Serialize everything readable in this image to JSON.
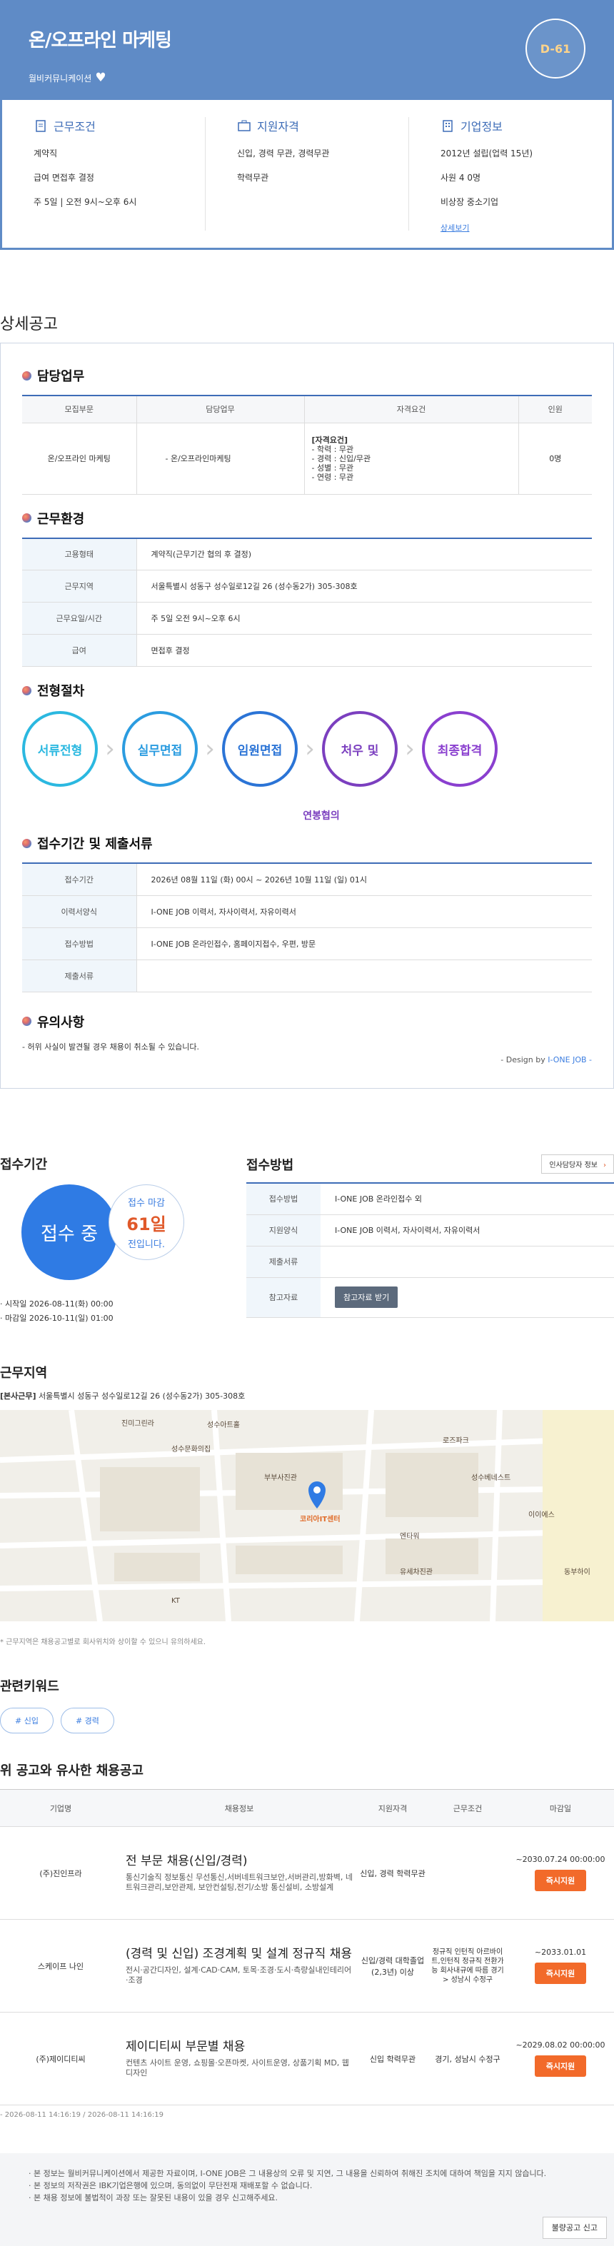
{
  "header": {
    "title": "온/오프라인 마케팅",
    "company": "월비커뮤니케이션",
    "dday": "D-61"
  },
  "summary": {
    "work": {
      "title": "근무조건",
      "rows": [
        "계약직",
        "급여 면접후 결정",
        "주 5일 | 오전 9시~오후 6시"
      ]
    },
    "qual": {
      "title": "지원자격",
      "rows": [
        "신입, 경력 무관, 경력무관",
        "학력무관"
      ]
    },
    "company": {
      "title": "기업정보",
      "rows": [
        "2012년 설립(업력 15년)",
        "사원 4 0명",
        "비상장 중소기업"
      ],
      "link": "상세보기"
    }
  },
  "detail_title": "상세공고",
  "duty": {
    "title": "담당업무",
    "headers": [
      "모집부문",
      "담당업무",
      "자격요건",
      "인원"
    ],
    "row": {
      "dept": "온/오프라인 마케팅",
      "task": "- 온/오프라인마케팅",
      "req": [
        "[자격요건]",
        "- 학력 : 무관",
        "- 경력 : 신입/무관",
        "- 성별 : 무관",
        "- 연령 : 무관"
      ],
      "count": "0명"
    }
  },
  "env": {
    "title": "근무환경",
    "rows": [
      {
        "k": "고용형태",
        "v": "계약직(근무기간 협의 후 결정)"
      },
      {
        "k": "근무지역",
        "v": "서울특별시 성동구 성수일로12길 26 (성수동2가) 305-308호"
      },
      {
        "k": "근무요일/시간",
        "v": "주 5일 오전 9시~오후 6시"
      },
      {
        "k": "급여",
        "v": "면접후 결정"
      }
    ]
  },
  "process": {
    "title": "전형절차",
    "steps": [
      {
        "label": "서류전형",
        "color": "#2bb8e0"
      },
      {
        "label": "실무면접",
        "color": "#2b9ce0"
      },
      {
        "label": "임원면접",
        "color": "#2b74d6"
      },
      {
        "label": "처우 및",
        "color": "#7b3fbf"
      },
      {
        "label": "최종합격",
        "color": "#8a3fcf"
      }
    ],
    "note": "연봉협의"
  },
  "period": {
    "title": "접수기간 및 제출서류",
    "rows": [
      {
        "k": "접수기간",
        "v": "2026년 08월 11일 (화) 00시 ~ 2026년 10월 11일 (일) 01시"
      },
      {
        "k": "이력서양식",
        "v": "I-ONE JOB 이력서, 자사이력서, 자유이력서"
      },
      {
        "k": "접수방법",
        "v": "I-ONE JOB 온라인접수, 홈페이지접수, 우편, 방문"
      },
      {
        "k": "제출서류",
        "v": ""
      }
    ]
  },
  "caution": {
    "title": "유의사항",
    "text": "- 허위 사실이 발견될 경우 채용이 취소될 수 있습니다.",
    "design_prefix": "- Design by",
    "design_brand": "I-ONE JOB -"
  },
  "apply_period": {
    "title": "접수기간",
    "status": "접수 중",
    "deadline_label": "접수 마감",
    "deadline_days": "61일",
    "deadline_suffix": "전입니다.",
    "start": "· 시작일 2026-08-11(화) 00:00",
    "end": "· 마감일 2026-10-11(일) 01:00"
  },
  "apply_method": {
    "title": "접수방법",
    "hr_button": "인사담당자 정보",
    "hr_arrow": "›",
    "rows": [
      {
        "k": "접수방법",
        "v": "I-ONE JOB 온라인접수 외"
      },
      {
        "k": "지원양식",
        "v": "I-ONE JOB 이력서, 자사이력서, 자유이력서"
      },
      {
        "k": "제출서류",
        "v": ""
      },
      {
        "k": "참고자료",
        "v": ""
      }
    ],
    "ref_button": "참고자료 받기"
  },
  "location": {
    "title": "근무지역",
    "addr_tag": "[본사근무]",
    "addr": " 서울특별시 성동구 성수일로12길 26 (성수동2가) 305-308호",
    "note": "* 근무지역은 채용공고별로 회사위치와 상이할 수 있으니 유의하세요.",
    "map_labels": [
      "진미그린라",
      "성수아트홀",
      "성수문화의집",
      "로즈파크",
      "엔타워",
      "KT",
      "성수베네스트",
      "이이에스",
      "동부하이",
      "부부사진관",
      "유세차진관",
      "코리아IT센터"
    ]
  },
  "keywords": {
    "title": "관련키워드",
    "items": [
      "# 신입",
      "# 경력"
    ]
  },
  "similar": {
    "title": "위 공고와 유사한 채용공고",
    "headers": [
      "기업명",
      "채용정보",
      "지원자격",
      "근무조건",
      "마감일"
    ],
    "rows": [
      {
        "company": "(주)진인프라",
        "title": "전 부문 채용(신입/경력)",
        "desc": "통신기술직 정보통신 무선통신,서버네트워크보안,서버관리,방화벽, 네트워크관리,보안관제, 보안컨설팅,전기/소방 통신설비, 소방설계",
        "qual": "신입, 경력 학력무관",
        "cond": "",
        "due": "~2030.07.24 00:00:00",
        "btn": "즉시지원"
      },
      {
        "company": "스케이프 나인",
        "title": "(경력 및 신입) 조경계획 및 설계 정규직 채용",
        "desc": "전시·공간디자인, 설계·CAD·CAM, 토목·조경·도시·측량실내인테리어·조경",
        "qual": "신입/경력 대학졸업(2,3년) 이상",
        "cond": "정규직 인턴직 아르바이트,인턴직 정규직 전환가능 회사내규에 따름 경기 > 성남시 수정구",
        "due": "~2033.01.01",
        "btn": "즉시지원"
      },
      {
        "company": "(주)제이디티씨",
        "title": "제이디티씨 부문별 채용",
        "desc": "컨텐츠 사이트 운영, 쇼핑몰·오픈마켓, 사이트운영, 상품기획 MD, 웹디자인",
        "qual": "신입 학력무관",
        "cond": "경기, 성남시 수정구",
        "due": "~2029.08.02 00:00:00",
        "btn": "즉시지원"
      }
    ],
    "timestamp": "- 2026-08-11 14:16:19 / 2026-08-11 14:16:19"
  },
  "footer": {
    "lines": [
      "· 본 정보는 월비커뮤니케이션에서 제공한 자료이며, I-ONE JOB은 그 내용상의 오류 및 지연, 그 내용을 신뢰하여 취해진 조치에 대하여 책임을 지지 않습니다.",
      "· 본 정보의 저작권은 IBK기업은행에 있으며, 동의없이 무단전재 재배포할 수 없습니다.",
      "· 본 채용 정보에 불법적이 과장 또는 잘못된 내용이 있을 경우 신고해주세요."
    ],
    "report": "불량공고 신고"
  }
}
